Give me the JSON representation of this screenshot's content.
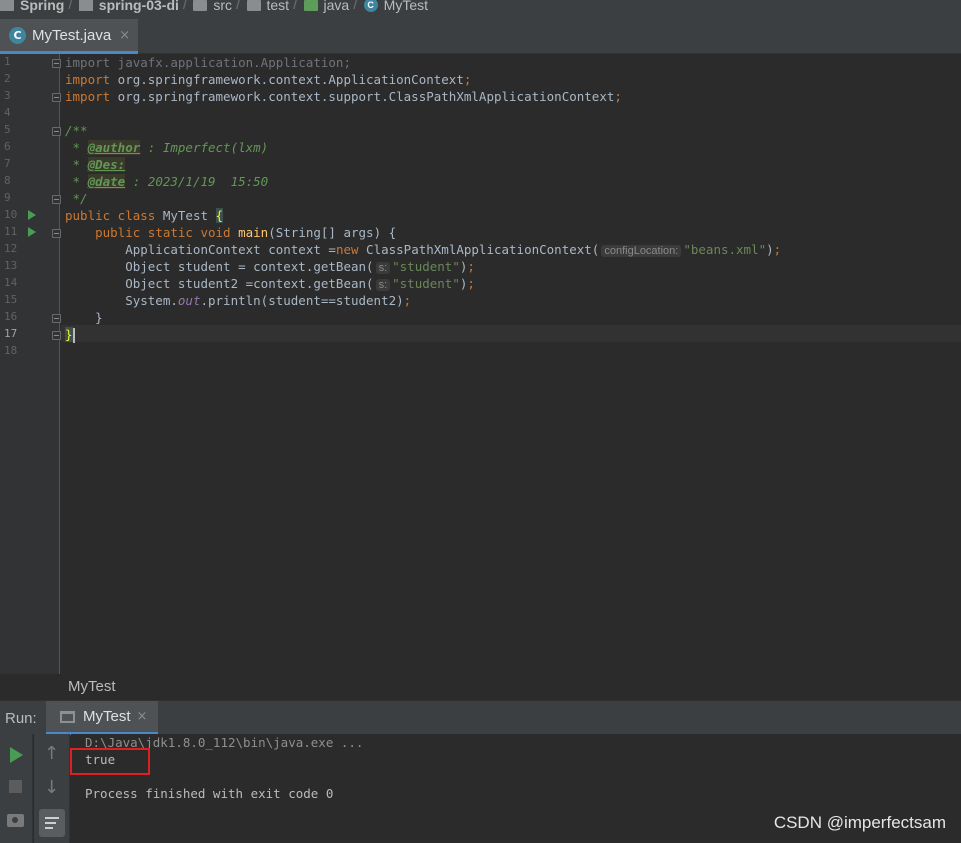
{
  "breadcrumb": {
    "items": [
      {
        "label": "Spring",
        "icon": "module-icon",
        "bold": true
      },
      {
        "label": "spring-03-di",
        "icon": "module-icon",
        "bold": true
      },
      {
        "label": "src",
        "icon": "folder-icon"
      },
      {
        "label": "test",
        "icon": "folder-icon"
      },
      {
        "label": "java",
        "icon": "green-folder-icon"
      },
      {
        "label": "MyTest",
        "icon": "class-icon"
      }
    ]
  },
  "editor_tab": {
    "label": "MyTest.java",
    "close": "×",
    "icon_letter": "C"
  },
  "editor": {
    "line_numbers": [
      "1",
      "2",
      "3",
      "4",
      "5",
      "6",
      "7",
      "8",
      "9",
      "10",
      "11",
      "12",
      "13",
      "14",
      "15",
      "16",
      "17",
      "18"
    ],
    "current_line": "17",
    "lines": {
      "l1": {
        "kw": "import",
        "rest": " javafx.application.Application;"
      },
      "l2": {
        "kw": "import",
        "rest": " org.springframework.context.ApplicationContext",
        "semi": ";"
      },
      "l3": {
        "kw": "import",
        "rest": " org.springframework.context.support.ClassPathXmlApplicationContext",
        "semi": ";"
      },
      "l5": "/**",
      "l6": {
        "star": " * ",
        "tag": "@author",
        "text": " : Imperfect(lxm)"
      },
      "l7": {
        "star": " * ",
        "tag": "@Des:"
      },
      "l8": {
        "star": " * ",
        "tag": "@date",
        "text": " : 2023/1/19  15:50"
      },
      "l9": " */",
      "l10": {
        "kw1": "public",
        "kw2": " class",
        "name": " MyTest ",
        "brace": "{"
      },
      "l11": {
        "indent": "    ",
        "kw": "public static void ",
        "fn": "main",
        "rest": "(String[] args) {"
      },
      "l12": {
        "a": "        ApplicationContext context =",
        "kw": "new",
        "b": " ClassPathXmlApplicationContext(",
        "hint": "configLocation:",
        "str": "\"beans.xml\"",
        "c": ")",
        "semi": ";"
      },
      "l13": {
        "a": "        Object student = context.getBean(",
        "hint": "s:",
        "str": "\"student\"",
        "c": ")",
        "semi": ";"
      },
      "l14": {
        "a": "        Object student2 =context.getBean(",
        "hint": "s:",
        "str": "\"student\"",
        "c": ")",
        "semi": ";"
      },
      "l15": {
        "a": "        System.",
        "stat": "out",
        "b": ".println(student==student2)",
        "semi": ";"
      },
      "l16": "    }",
      "l17": "}"
    }
  },
  "structure_label": "MyTest",
  "run_panel": {
    "title": "Run:",
    "tab_label": "MyTest",
    "tab_close": "×",
    "output": {
      "command": "D:\\Java\\jdk1.8.0_112\\bin\\java.exe ...",
      "result": "true",
      "finished": "Process finished with exit code 0"
    },
    "up_arrow": "↑",
    "down_arrow": "↓"
  },
  "watermark": "CSDN @imperfectsam",
  "colors": {
    "keyword": "#cc7832",
    "string": "#6a8759",
    "doc": "#629755",
    "method": "#ffc66d",
    "run_green": "#499c54",
    "highlight_red": "#e02020"
  }
}
